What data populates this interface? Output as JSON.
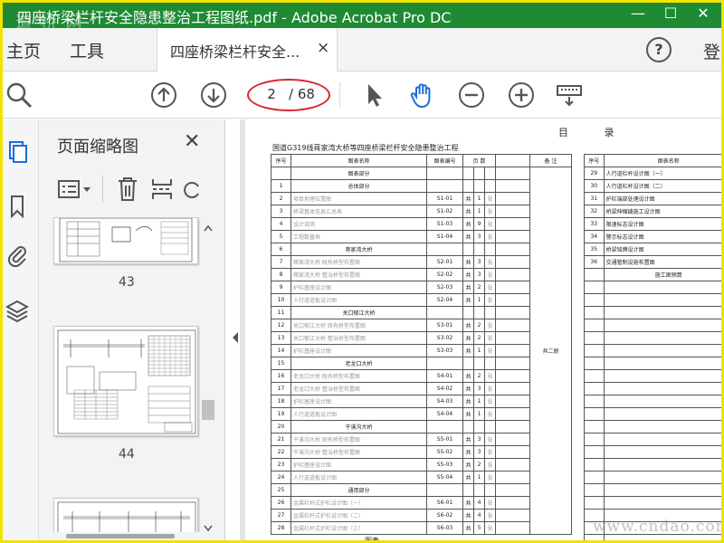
{
  "window": {
    "title": "四座桥梁栏杆安全隐患整治工程图纸.pdf - Adobe Acrobat Pro DC",
    "watermark_top": "道 桥 网",
    "minimize": "—",
    "maximize": "☐",
    "close": "✕"
  },
  "menu": {
    "home": "主页",
    "tools": "工具",
    "doc_tab": "四座桥梁栏杆安全...",
    "doc_tab_close": "×",
    "help": "?",
    "sign_in": "登"
  },
  "toolbar": {
    "page_current": "2",
    "page_total": "/ 68"
  },
  "thumbnails": {
    "title": "页面缩略图",
    "close": "✕",
    "pages": [
      "43",
      "44"
    ]
  },
  "document": {
    "heading": "目 录",
    "subtitle": "国道G319线蒋家湾大桥等四座桥梁栏杆安全隐患整治工程",
    "left_headers": [
      "序号",
      "图表名称",
      "图表编号",
      "页 数",
      "备 注"
    ],
    "right_headers": [
      "序号",
      "图表名称"
    ],
    "left_rows": [
      {
        "no": "",
        "name": "图表部分",
        "code": "",
        "a": "",
        "b": "",
        "c": "",
        "sect": true
      },
      {
        "no": "1",
        "name": "总体部分",
        "code": "",
        "a": "",
        "b": "",
        "c": "",
        "sect": true
      },
      {
        "no": "2",
        "name": "项目地理位置图",
        "code": "S1-01",
        "a": "共",
        "b": "1",
        "c": "张"
      },
      {
        "no": "3",
        "name": "桥梁基本信息汇总表",
        "code": "S1-02",
        "a": "共",
        "b": "1",
        "c": "张"
      },
      {
        "no": "4",
        "name": "设计说明",
        "code": "S1-03",
        "a": "共",
        "b": "9",
        "c": "张"
      },
      {
        "no": "5",
        "name": "工程数量表",
        "code": "S1-04",
        "a": "共",
        "b": "3",
        "c": "张"
      },
      {
        "no": "6",
        "name": "蒋家湾大桥",
        "code": "",
        "a": "",
        "b": "",
        "c": "",
        "sect": true
      },
      {
        "no": "7",
        "name": "蒋家湾大桥 既有桥型布置图",
        "code": "S2-01",
        "a": "共",
        "b": "3",
        "c": "张"
      },
      {
        "no": "8",
        "name": "蒋家湾大桥 整治桥型布置图",
        "code": "S2-02",
        "a": "共",
        "b": "3",
        "c": "张"
      },
      {
        "no": "9",
        "name": "护栏基座设计图",
        "code": "S2-03",
        "a": "共",
        "b": "2",
        "c": "张"
      },
      {
        "no": "10",
        "name": "人行道道板设计图",
        "code": "S2-04",
        "a": "共",
        "b": "1",
        "c": "张"
      },
      {
        "no": "11",
        "name": "关口郁江大桥",
        "code": "",
        "a": "",
        "b": "",
        "c": "",
        "sect": true
      },
      {
        "no": "12",
        "name": "关口郁江大桥 既有桥型布置图",
        "code": "S3-01",
        "a": "共",
        "b": "2",
        "c": "张"
      },
      {
        "no": "13",
        "name": "关口郁江大桥 整治桥型布置图",
        "code": "S3-02",
        "a": "共",
        "b": "2",
        "c": "张"
      },
      {
        "no": "14",
        "name": "护栏基座设计图",
        "code": "S3-03",
        "a": "共",
        "b": "1",
        "c": "张"
      },
      {
        "no": "15",
        "name": "老龙口大桥",
        "code": "",
        "a": "",
        "b": "",
        "c": "",
        "sect": true
      },
      {
        "no": "16",
        "name": "老龙口大桥 既有桥型布置图",
        "code": "S4-01",
        "a": "共",
        "b": "2",
        "c": "张"
      },
      {
        "no": "17",
        "name": "老龙口大桥 整治桥型布置图",
        "code": "S4-02",
        "a": "共",
        "b": "3",
        "c": "张"
      },
      {
        "no": "18",
        "name": "护栏基座设计图",
        "code": "S4-03",
        "a": "共",
        "b": "1",
        "c": "张"
      },
      {
        "no": "19",
        "name": "人行道道板设计图",
        "code": "S4-04",
        "a": "共",
        "b": "1",
        "c": "张"
      },
      {
        "no": "20",
        "name": "干溪沟大桥",
        "code": "",
        "a": "",
        "b": "",
        "c": "",
        "sect": true
      },
      {
        "no": "21",
        "name": "干溪沟大桥 既有桥型布置图",
        "code": "S5-01",
        "a": "共",
        "b": "3",
        "c": "张"
      },
      {
        "no": "22",
        "name": "干溪沟大桥 整治桥型布置图",
        "code": "S5-02",
        "a": "共",
        "b": "3",
        "c": "张"
      },
      {
        "no": "23",
        "name": "护栏基座设计图",
        "code": "S5-03",
        "a": "共",
        "b": "2",
        "c": "张"
      },
      {
        "no": "24",
        "name": "人行道道板设计图",
        "code": "S5-04",
        "a": "共",
        "b": "1",
        "c": "张"
      },
      {
        "no": "25",
        "name": "通用部分",
        "code": "",
        "a": "",
        "b": "",
        "c": "",
        "sect": true
      },
      {
        "no": "26",
        "name": "金属栏杆式护栏设计图（一）",
        "code": "S6-01",
        "a": "共",
        "b": "4",
        "c": "张"
      },
      {
        "no": "27",
        "name": "金属栏杆式护栏设计图（二）",
        "code": "S6-02",
        "a": "共",
        "b": "4",
        "c": "张"
      },
      {
        "no": "28",
        "name": "金属栏杆式护栏设计图（三）",
        "code": "S6-03",
        "a": "共",
        "b": "5",
        "c": "张"
      }
    ],
    "remark_merged": "共二册",
    "right_rows": [
      {
        "no": "29",
        "name": "人行道栏杆设计图（一）"
      },
      {
        "no": "30",
        "name": "人行道栏杆设计图（二）"
      },
      {
        "no": "31",
        "name": "护栏端部处理设计图"
      },
      {
        "no": "32",
        "name": "桥梁伸缩缝施工设计图"
      },
      {
        "no": "33",
        "name": "限速标志设计图"
      },
      {
        "no": "34",
        "name": "警示标志设计图"
      },
      {
        "no": "35",
        "name": "桥梁铭牌设计图"
      },
      {
        "no": "36",
        "name": "交通管制设施布置图"
      },
      {
        "no": "",
        "name": "施工图预算"
      }
    ],
    "bottom_fragment": "图表"
  },
  "watermark_bottom": "www.cndao.com",
  "colors": {
    "titlebar": "#1e8a34",
    "outer_frame": "#f2e200",
    "highlight_oval": "#d8262a",
    "hand_tool": "#1a6fd6"
  }
}
